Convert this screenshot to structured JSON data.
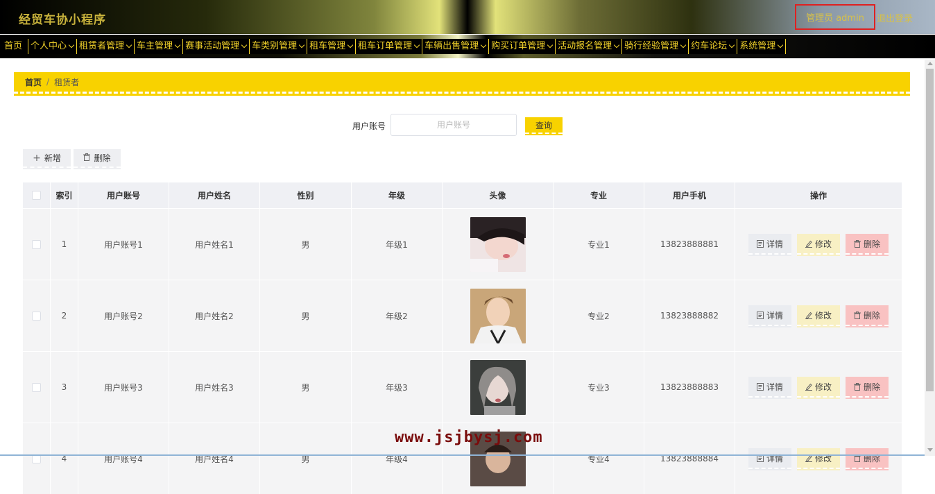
{
  "header": {
    "title": "经贸车协小程序",
    "user": "管理员 admin",
    "logout": "退出登录"
  },
  "nav": [
    {
      "label": "首页",
      "dropdown": false
    },
    {
      "label": "个人中心",
      "dropdown": true
    },
    {
      "label": "租赁者管理",
      "dropdown": true
    },
    {
      "label": "车主管理",
      "dropdown": true
    },
    {
      "label": "赛事活动管理",
      "dropdown": true
    },
    {
      "label": "车类别管理",
      "dropdown": true
    },
    {
      "label": "租车管理",
      "dropdown": true
    },
    {
      "label": "租车订单管理",
      "dropdown": true
    },
    {
      "label": "车辆出售管理",
      "dropdown": true
    },
    {
      "label": "购买订单管理",
      "dropdown": true
    },
    {
      "label": "活动报名管理",
      "dropdown": true
    },
    {
      "label": "骑行经验管理",
      "dropdown": true
    },
    {
      "label": "约车论坛",
      "dropdown": true
    },
    {
      "label": "系统管理",
      "dropdown": true
    }
  ],
  "breadcrumb": {
    "home": "首页",
    "separator": "/",
    "current": "租赁者"
  },
  "search": {
    "label": "用户账号",
    "placeholder": "用户账号",
    "value": "",
    "button": "查询"
  },
  "toolbar": {
    "add": "新增",
    "delete": "删除"
  },
  "table": {
    "headers": [
      "索引",
      "用户账号",
      "用户姓名",
      "性别",
      "年级",
      "头像",
      "专业",
      "用户手机",
      "操作"
    ],
    "rows": [
      {
        "index": "1",
        "account": "用户账号1",
        "name": "用户姓名1",
        "sex": "男",
        "grade": "年级1",
        "major": "专业1",
        "phone": "13823888881"
      },
      {
        "index": "2",
        "account": "用户账号2",
        "name": "用户姓名2",
        "sex": "男",
        "grade": "年级2",
        "major": "专业2",
        "phone": "13823888882"
      },
      {
        "index": "3",
        "account": "用户账号3",
        "name": "用户姓名3",
        "sex": "男",
        "grade": "年级3",
        "major": "专业3",
        "phone": "13823888883"
      },
      {
        "index": "4",
        "account": "用户账号4",
        "name": "用户姓名4",
        "sex": "男",
        "grade": "年级4",
        "major": "专业4",
        "phone": "13823888884"
      }
    ],
    "actions": {
      "detail": "详情",
      "edit": "修改",
      "delete": "删除"
    }
  },
  "watermark": "www.jsjbysj.com",
  "colors": {
    "accent": "#f8d200",
    "nav_text": "#f2d22a",
    "danger": "#f9c2c2",
    "edit": "#f8f0c4"
  }
}
